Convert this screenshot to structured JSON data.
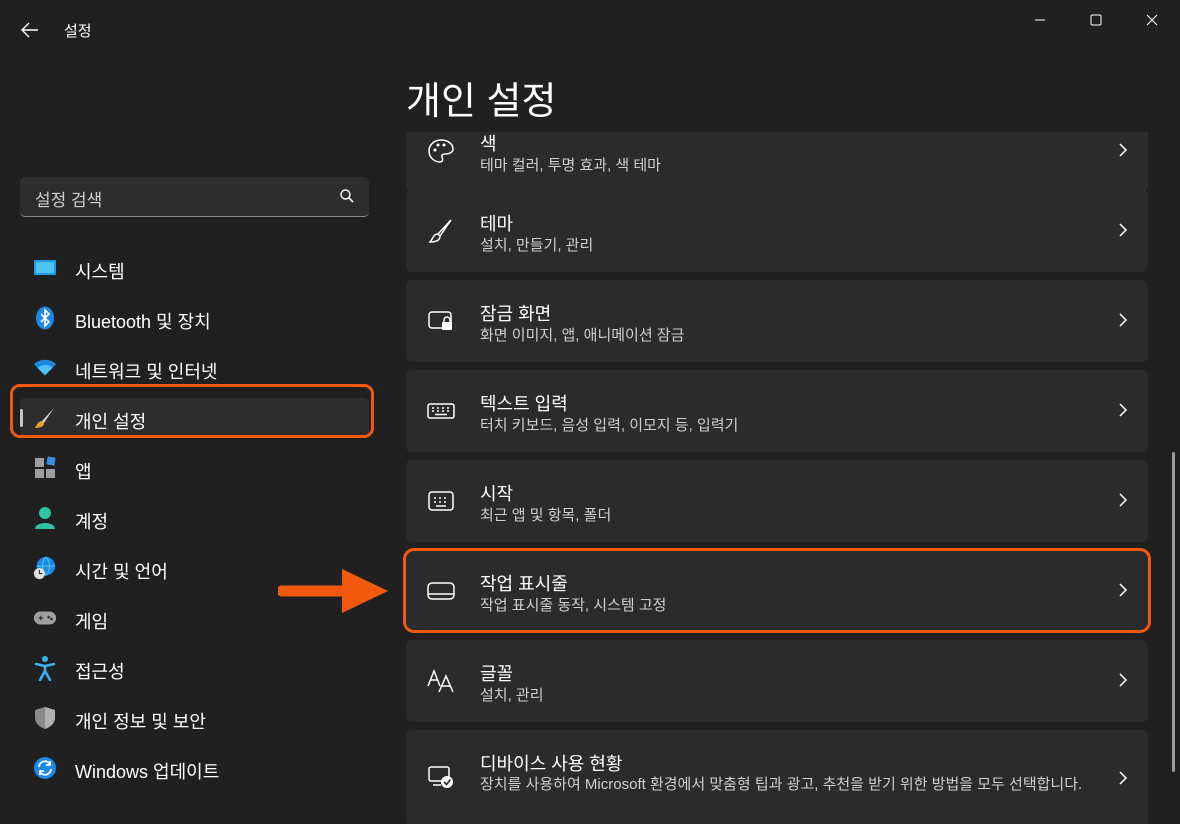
{
  "window": {
    "title": "설정",
    "back_icon": "back-arrow-icon",
    "controls": [
      "minimize-icon",
      "maximize-icon",
      "close-icon"
    ]
  },
  "search": {
    "placeholder": "설정 검색",
    "icon": "search-icon"
  },
  "sidebar": {
    "items": [
      {
        "label": "시스템",
        "icon": "system-monitor-icon"
      },
      {
        "label": "Bluetooth 및 장치",
        "icon": "bluetooth-icon"
      },
      {
        "label": "네트워크 및 인터넷",
        "icon": "wifi-icon"
      },
      {
        "label": "개인 설정",
        "icon": "paintbrush-icon",
        "selected": true
      },
      {
        "label": "앱",
        "icon": "apps-icon"
      },
      {
        "label": "계정",
        "icon": "account-icon"
      },
      {
        "label": "시간 및 언어",
        "icon": "globe-clock-icon"
      },
      {
        "label": "게임",
        "icon": "gamepad-icon"
      },
      {
        "label": "접근성",
        "icon": "accessibility-icon"
      },
      {
        "label": "개인 정보 및 보안",
        "icon": "shield-icon"
      },
      {
        "label": "Windows 업데이트",
        "icon": "update-icon"
      }
    ]
  },
  "main": {
    "page_title": "개인 설정",
    "cards": [
      {
        "title": "색",
        "subtitle": "테마 컬러, 투명 효과, 색 테마",
        "icon": "palette-icon"
      },
      {
        "title": "테마",
        "subtitle": "설치, 만들기, 관리",
        "icon": "brush-icon"
      },
      {
        "title": "잠금 화면",
        "subtitle": "화면 이미지, 앱, 애니메이션 잠금",
        "icon": "lock-screen-icon"
      },
      {
        "title": "텍스트 입력",
        "subtitle": "터치 키보드, 음성 입력, 이모지 등, 입력기",
        "icon": "keyboard-icon"
      },
      {
        "title": "시작",
        "subtitle": "최근 앱 및 항목, 폴더",
        "icon": "start-menu-icon"
      },
      {
        "title": "작업 표시줄",
        "subtitle": "작업 표시줄 동작, 시스템 고정",
        "icon": "taskbar-icon",
        "highlighted": true
      },
      {
        "title": "글꼴",
        "subtitle": "설치, 관리",
        "icon": "fonts-icon"
      },
      {
        "title": "디바이스 사용 현황",
        "subtitle": "장치를 사용하여 Microsoft 환경에서 맞춤형 팁과 광고, 추천을 받기 위한 방법을 모두 선택합니다.",
        "icon": "device-usage-icon"
      }
    ]
  },
  "annotations": {
    "highlight_color": "#f2590f"
  },
  "colors": {
    "background": "#202020",
    "card": "#2b2b2b",
    "accent": "#4cc2ff"
  }
}
